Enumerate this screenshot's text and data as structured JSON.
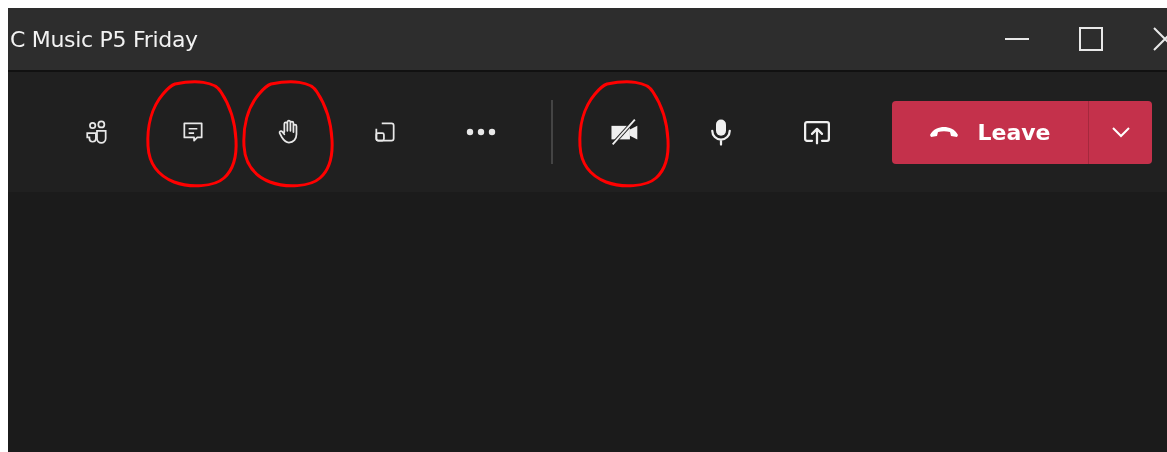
{
  "window": {
    "title": "C Music P5 Friday"
  },
  "toolbar": {
    "groups": [
      {
        "items": [
          {
            "kind": "people",
            "circled": false
          },
          {
            "kind": "chat",
            "circled": true
          },
          {
            "kind": "hand",
            "circled": true
          },
          {
            "kind": "rooms",
            "circled": false
          },
          {
            "kind": "more",
            "circled": false
          }
        ]
      },
      {
        "items": [
          {
            "kind": "camera-off",
            "circled": true
          },
          {
            "kind": "mic",
            "circled": false
          },
          {
            "kind": "share",
            "circled": false
          }
        ]
      }
    ]
  },
  "leave_button": {
    "label": "Leave"
  }
}
